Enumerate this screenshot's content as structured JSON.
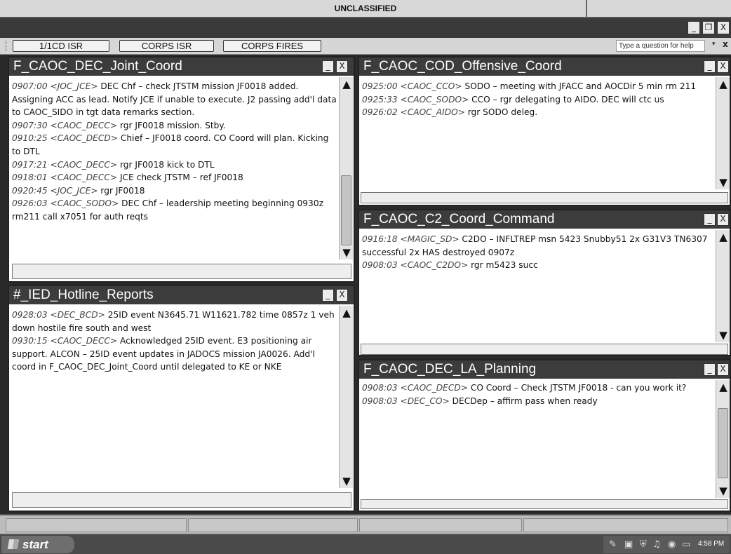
{
  "classification": "UNCLASSIFIED",
  "window_buttons": {
    "minimize": "_",
    "restore": "❐",
    "close": "X"
  },
  "toolbar": {
    "tabs": [
      "1/1CD ISR",
      "CORPS ISR",
      "CORPS FIRES"
    ],
    "help_placeholder": "Type a question for help",
    "help_arrow": "▾",
    "help_close": "x"
  },
  "panel_buttons": {
    "minimize": "_",
    "close": "X"
  },
  "scroll": {
    "up": "▲",
    "down": "▼"
  },
  "panels": {
    "joint_coord": {
      "title": "F_CAOC_DEC_Joint_Coord",
      "messages": [
        {
          "stamp": "0907:00 <JOC_JCE>",
          "text": " DEC Chf – check JTSTM mission JF0018 added.  Assigning ACC as lead.  Notify JCE if unable to execute.  J2 passing add'l data to CAOC_SIDO in tgt data remarks section."
        },
        {
          "stamp": "0907:30 <CAOC_DECC>",
          "text": " rgr JF0018 mission. Stby."
        },
        {
          "stamp": "0910:25 <CAOC_DECD>",
          "text": " Chief – JF0018 coord.  CO Coord will plan.  Kicking to DTL"
        },
        {
          "stamp": "0917:21 <CAOC_DECC>",
          "text": " rgr JF0018 kick to DTL"
        },
        {
          "stamp": "0918:01 <CAOC_DECC>",
          "text": " JCE check JTSTM – ref JF0018"
        },
        {
          "stamp": "0920:45 <JOC_JCE>",
          "text": " rgr JF0018"
        },
        {
          "stamp": "0926:03 <CAOC_SODO>",
          "text": " DEC Chf – leadership meeting beginning 0930z rm211 call x7051 for auth reqts"
        }
      ]
    },
    "ied_hotline": {
      "title": "#_IED_Hotline_Reports",
      "messages": [
        {
          "stamp": "0928:03 <DEC_BCD>",
          "text": " 25ID event N3645.71 W11621.782 time 0857z 1 veh down hostile fire south and west"
        },
        {
          "stamp": "0930:15 <CAOC_DECC>",
          "text": " Acknowledged 25ID event.  E3 positioning air support.  ALCON – 25ID event updates in JADOCS mission JA0026.  Add'l coord in F_CAOC_DEC_Joint_Coord until delegated to KE or NKE"
        }
      ]
    },
    "offensive_coord": {
      "title": "F_CAOC_COD_Offensive_Coord",
      "messages": [
        {
          "stamp": "0925:00 <CAOC_CCO>",
          "text": " SODO – meeting with JFACC and AOCDir 5 min rm 211"
        },
        {
          "stamp": "0925:33 <CAOC_SODO>",
          "text": " CCO – rgr delegating to AIDO.  DEC will ctc us"
        },
        {
          "stamp": "0926:02 <CAOC_AIDO>",
          "text": " rgr SODO deleg."
        }
      ]
    },
    "c2_coord": {
      "title": "F_CAOC_C2_Coord_Command",
      "messages": [
        {
          "stamp": "0916:18 <MAGIC_SD>",
          "text": " C2DO – INFLTREP msn 5423 Snubby51 2x G31V3 TN6307 successful 2x HAS destroyed 0907z"
        },
        {
          "stamp": "0908:03 <CAOC_C2DO>",
          "text": " rgr m5423 succ"
        }
      ]
    },
    "la_planning": {
      "title": "F_CAOC_DEC_LA_Planning",
      "messages": [
        {
          "stamp": "0908:03 <CAOC_DECD>",
          "text": " CO Coord – Check JTSTM JF0018 - can you work it?"
        },
        {
          "stamp": "0908:03 <DEC_CO>",
          "text": " DECDep – affirm pass when ready"
        }
      ]
    }
  },
  "taskbar": {
    "start_label": "start",
    "clock": "4:58 PM"
  }
}
